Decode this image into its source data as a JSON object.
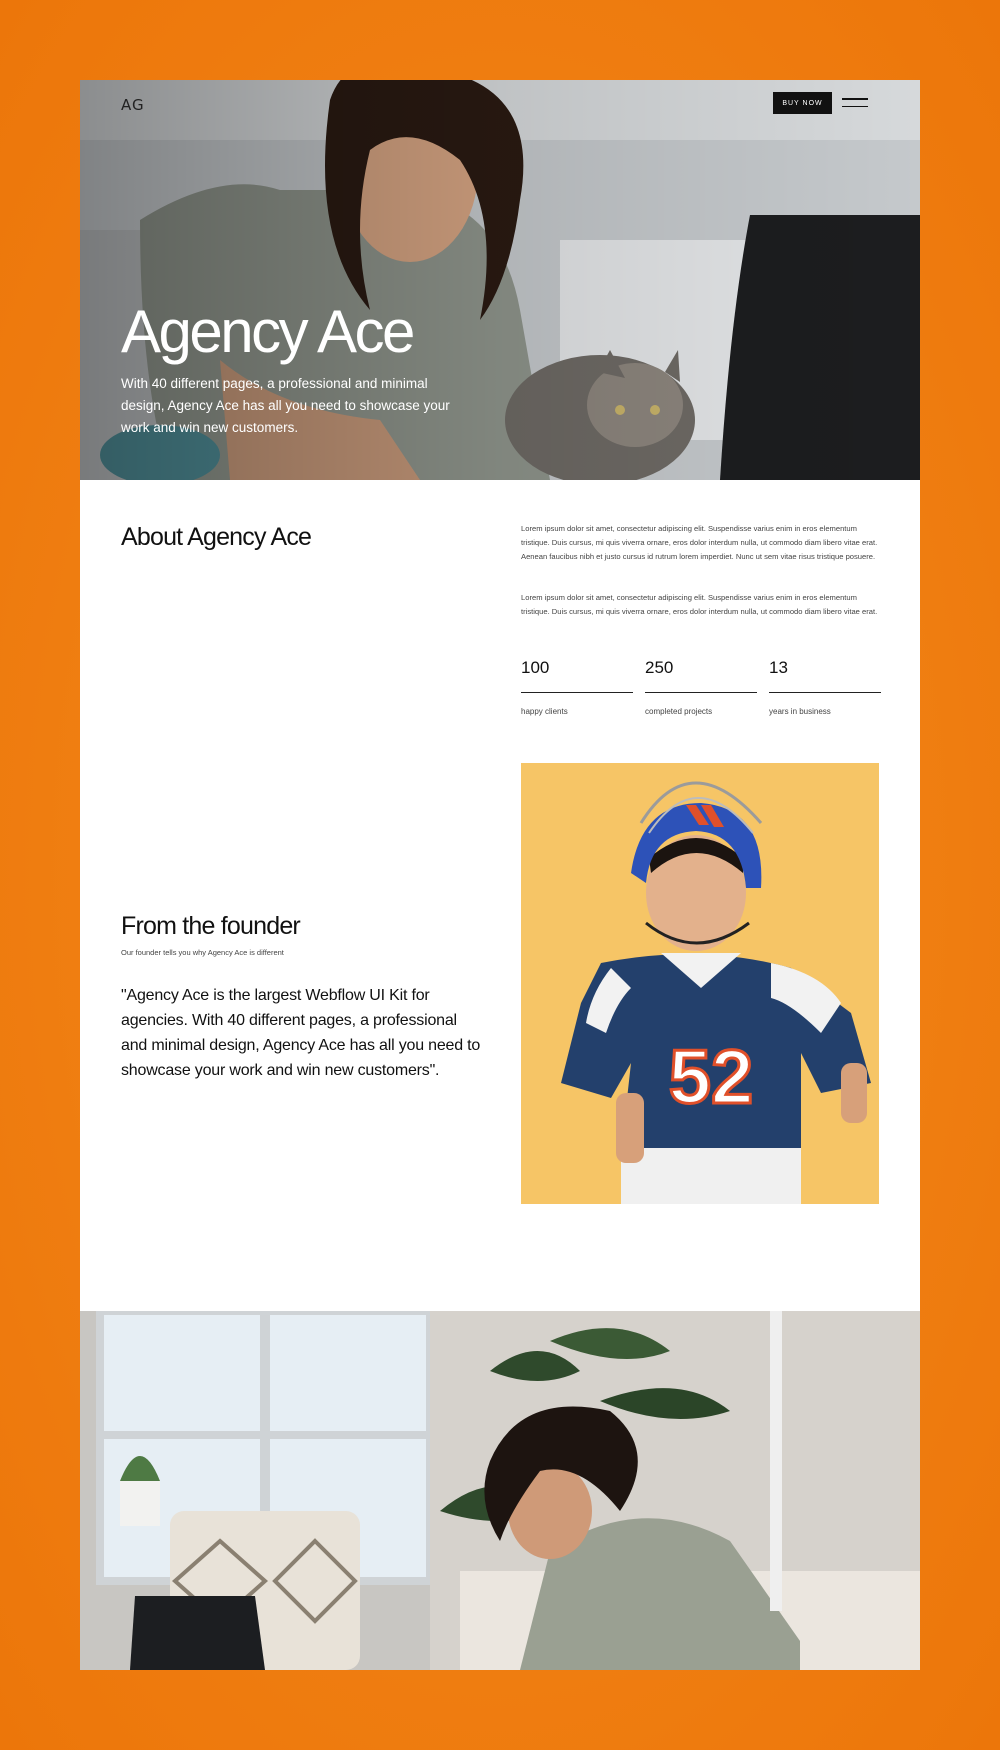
{
  "colors": {
    "frame_orange": "#f07f12",
    "button_bg": "#111111",
    "hero_text": "#ffffff",
    "photo_yellow": "#f6c566"
  },
  "nav": {
    "logo": "AG",
    "buy_button": "BUY NOW",
    "menu_icon": "hamburger-icon"
  },
  "hero": {
    "title": "Agency Ace",
    "subtitle": "With 40 different pages, a professional and minimal design, Agency Ace has all you need to showcase your work and win new customers.",
    "image": "woman-with-cat-and-laptop"
  },
  "about": {
    "title": "About Agency Ace",
    "paragraph_1": "Lorem ipsum dolor sit amet, consectetur adipiscing elit. Suspendisse varius enim in eros elementum tristique. Duis cursus, mi quis viverra ornare, eros dolor interdum nulla, ut commodo diam libero vitae erat. Aenean faucibus nibh et justo cursus id rutrum lorem imperdiet. Nunc ut sem vitae risus tristique posuere.",
    "paragraph_2": "Lorem ipsum dolor sit amet, consectetur adipiscing elit. Suspendisse varius enim in eros elementum tristique. Duis cursus, mi quis viverra ornare, eros dolor interdum nulla, ut commodo diam libero vitae erat.",
    "stats": [
      {
        "value": "100",
        "label": "happy clients"
      },
      {
        "value": "250",
        "label": "completed projects"
      },
      {
        "value": "13",
        "label": "years in business"
      }
    ]
  },
  "founder": {
    "title": "From the founder",
    "subtitle": "Our founder tells you why Agency Ace is different",
    "quote": "\"Agency Ace is the largest Webflow UI Kit for agencies. With 40 different pages, a professional and minimal design, Agency Ace has all you need to showcase your work and win new customers\".",
    "image": "child-in-football-jersey",
    "jersey_number": "52"
  },
  "bottom": {
    "image": "woman-writing-in-living-room"
  }
}
